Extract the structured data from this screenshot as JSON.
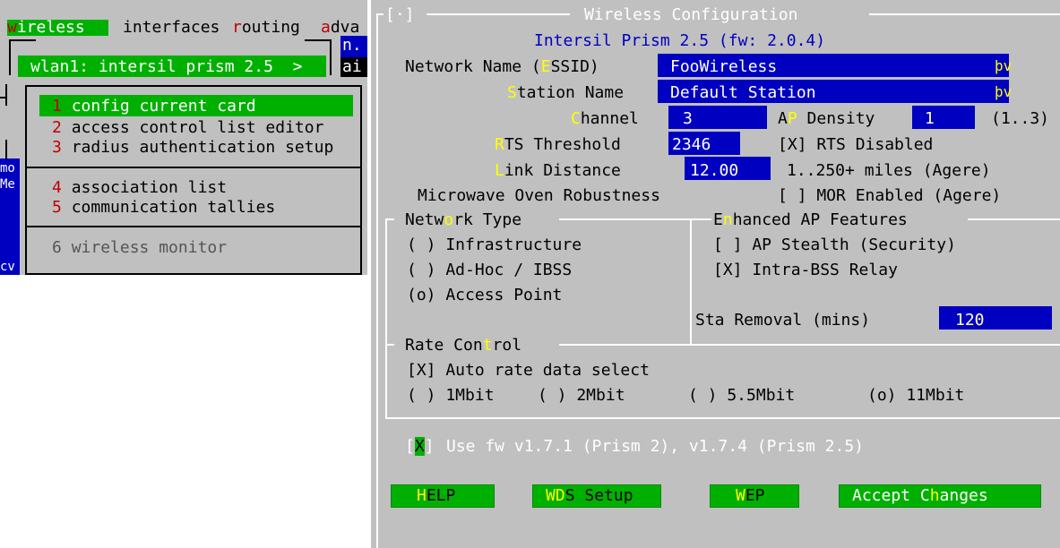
{
  "left": {
    "menubar": {
      "items": [
        {
          "hot": "w",
          "rest": "ireless",
          "selected": true
        },
        {
          "hot": "",
          "rest": "interfaces",
          "selected": false
        },
        {
          "hot": "r",
          "rest": "outing",
          "selected": false
        },
        {
          "hot": "a",
          "rest": "dva",
          "selected": false
        }
      ]
    },
    "card_selector": "wlan1: intersil prism 2.5  >",
    "bg_fragments": [
      "n.",
      "ai",
      "mo",
      "Me",
      "cv"
    ],
    "menu": {
      "items": [
        {
          "num": "1",
          "label": "config current card",
          "selected": true
        },
        {
          "num": "2",
          "label": "access control list editor",
          "selected": false
        },
        {
          "num": "3",
          "label": "radius authentication setup",
          "selected": false
        },
        {
          "num": "4",
          "label": "association list",
          "selected": false
        },
        {
          "num": "5",
          "label": "communication tallies",
          "selected": false
        },
        {
          "num": "6",
          "label": "wireless monitor",
          "selected": false,
          "disabled": true
        }
      ]
    }
  },
  "right": {
    "window_title": "Wireless Configuration",
    "close_box": "[·]",
    "card_info": "Intersil Prism 2.5 (fw: 2.0.4)",
    "fields": {
      "essid": {
        "label_pre": "Network Name (",
        "hot": "E",
        "label_post": "SSID)",
        "value": "FooWireless",
        "marker": "þv"
      },
      "station": {
        "label_pre": "",
        "hot": "S",
        "label_post": "tation Name",
        "value": "Default Station",
        "marker": "þv"
      },
      "channel": {
        "label_pre": "",
        "hot": "C",
        "label_post": "hannel",
        "value": "3"
      },
      "ap_density": {
        "label_pre": "A",
        "hot": "P",
        "label_post": " Density",
        "value": "1",
        "range": "(1..3)"
      },
      "rts": {
        "label_pre": "",
        "hot": "R",
        "label_post": "TS Threshold",
        "value": "2346",
        "check": "[X] RTS Disabled"
      },
      "link": {
        "label_pre": "",
        "hot": "L",
        "label_post": "ink Distance",
        "value": "12.00",
        "note": "1..250+ miles (Agere)"
      },
      "mor": {
        "label": "Microwave Oven Robustness",
        "check": "[ ] MOR Enabled (Agere)"
      }
    },
    "network_type": {
      "title_pre": "Netw",
      "title_hot": "o",
      "title_post": "rk Type",
      "options": [
        "( ) Infrastructure",
        "( ) Ad-Hoc / IBSS",
        "(o) Access Point"
      ]
    },
    "enhanced": {
      "title_pre": "E",
      "title_hot": "n",
      "title_post": "hanced AP Features",
      "options": [
        "[ ] AP Stealth (Security)",
        "[X] Intra-BSS Relay"
      ],
      "sta_removal_label": "Sta Removal (mins)",
      "sta_removal_value": "120"
    },
    "rate": {
      "title_pre": "Rate Con",
      "title_hot": "t",
      "title_post": "rol",
      "auto": "[X] Auto rate data select",
      "rates": [
        "( ) 1Mbit",
        "( ) 2Mbit",
        "( ) 5.5Mbit",
        "(o) 11Mbit"
      ]
    },
    "fw": {
      "open": "[",
      "mark": "X",
      "close": "]",
      "label": "Use fw v1.7.1 (Prism 2), v1.7.4 (Prism 2.5)"
    },
    "buttons": {
      "help": {
        "hot": "H",
        "rest": "ELP"
      },
      "wds": {
        "pre": "W",
        "hot": "D",
        "rest": "S Setup"
      },
      "wep": {
        "hot": "W",
        "rest": "EP"
      },
      "accept": {
        "pre": "Accept C",
        "hot": "h",
        "rest": "anges"
      }
    }
  },
  "colors": {
    "gray": "#c0c0c0",
    "blue": "#0000c0",
    "green": "#00b000",
    "hotkey_yellow": "#ffff00",
    "hotkey_red": "#c00000"
  }
}
